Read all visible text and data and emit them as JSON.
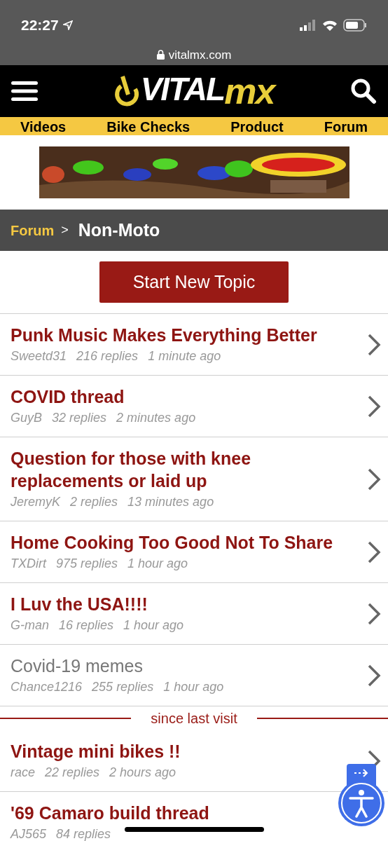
{
  "status_bar": {
    "time": "22:27"
  },
  "address_bar": {
    "url": "vitalmx.com"
  },
  "header": {
    "logo_parts": [
      {
        "text": "VITAL",
        "accent": false
      },
      {
        "text": "mx",
        "accent": true
      }
    ]
  },
  "nav": [
    "Videos",
    "Bike Checks",
    "Product",
    "Forum"
  ],
  "breadcrumb": {
    "parent": "Forum",
    "separator": ">",
    "current": "Non-Moto"
  },
  "start_button": "Start New Topic",
  "new_topics": [
    {
      "title": "Punk Music Makes Everything Better",
      "author": "Sweetd31",
      "replies": "216 replies",
      "time": "1 minute ago",
      "read": false,
      "chevron": true
    },
    {
      "title": "COVID thread",
      "author": "GuyB",
      "replies": "32 replies",
      "time": "2 minutes ago",
      "read": false,
      "chevron": true
    },
    {
      "title": "Question for those with knee replacements or laid up",
      "author": "JeremyK",
      "replies": "2 replies",
      "time": "13 minutes ago",
      "read": false,
      "chevron": true
    },
    {
      "title": "Home Cooking Too Good Not To Share",
      "author": "TXDirt",
      "replies": "975 replies",
      "time": "1 hour ago",
      "read": false,
      "chevron": true
    },
    {
      "title": "I Luv the USA!!!!",
      "author": "G-man",
      "replies": "16 replies",
      "time": "1 hour ago",
      "read": false,
      "chevron": true
    },
    {
      "title": "Covid-19 memes",
      "author": "Chance1216",
      "replies": "255 replies",
      "time": "1 hour ago",
      "read": true,
      "chevron": true
    }
  ],
  "divider": "since last visit",
  "older_topics": [
    {
      "title": "Vintage mini bikes !!",
      "author": "race",
      "replies": "22 replies",
      "time": "2 hours ago",
      "read": false,
      "chevron": true
    },
    {
      "title": "'69 Camaro build thread",
      "author": "AJ565",
      "replies": "84 replies",
      "read": false,
      "chevron": false
    }
  ]
}
